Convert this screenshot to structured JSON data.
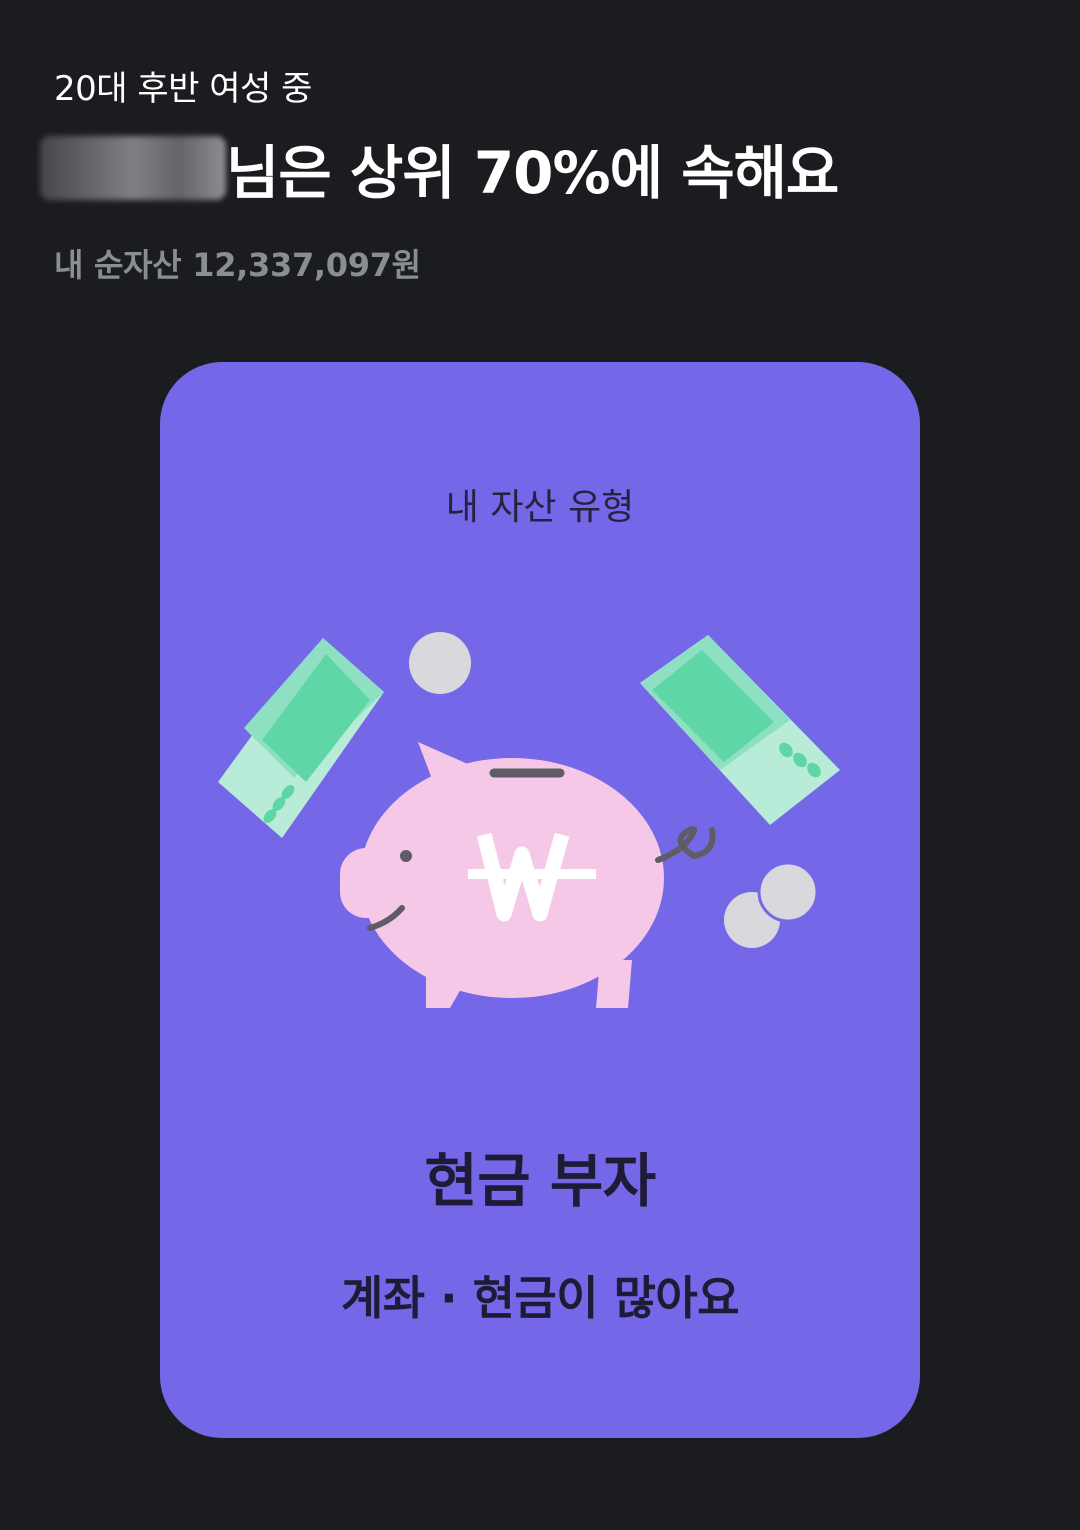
{
  "header": {
    "segment": "20대 후반 여성 중",
    "rank_text": "님은 상위 70%에 속해요",
    "net_assets": "내 순자산 12,337,097원"
  },
  "card": {
    "label": "내 자산 유형",
    "type_title": "현금 부자",
    "type_description": "계좌 · 현금이 많아요",
    "illustration_icon": "piggy-bank-won-icon",
    "colors": {
      "background": "#7568e8",
      "pig": "#f5c8e8",
      "money": "#5fd6a6",
      "coin": "#d9d9dd"
    }
  },
  "colors": {
    "page_background": "#1b1c20",
    "headline": "#ffffff",
    "muted": "#8b8d95"
  }
}
